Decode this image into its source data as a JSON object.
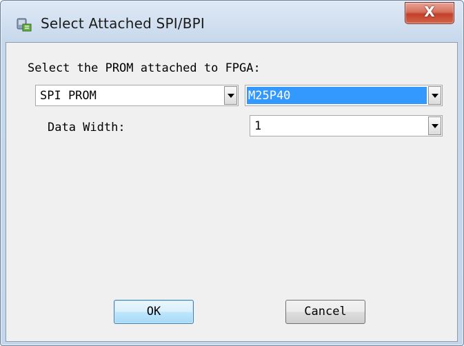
{
  "window": {
    "title": "Select Attached SPI/BPI",
    "icon": "chip-programmer-icon",
    "close_label": "X"
  },
  "dialog": {
    "prompt": "Select the PROM attached to FPGA:",
    "prom_type": {
      "value": "SPI PROM",
      "options": [
        "SPI PROM"
      ]
    },
    "prom_part": {
      "value": "M25P40",
      "options": [
        "M25P40"
      ]
    },
    "data_width_label": "Data Width:",
    "data_width": {
      "value": "1",
      "options": [
        "1"
      ]
    }
  },
  "buttons": {
    "ok": "OK",
    "cancel": "Cancel"
  },
  "colors": {
    "selection": "#3399ff",
    "client_bg": "#f0f0f0",
    "close_red": "#c1402a"
  }
}
